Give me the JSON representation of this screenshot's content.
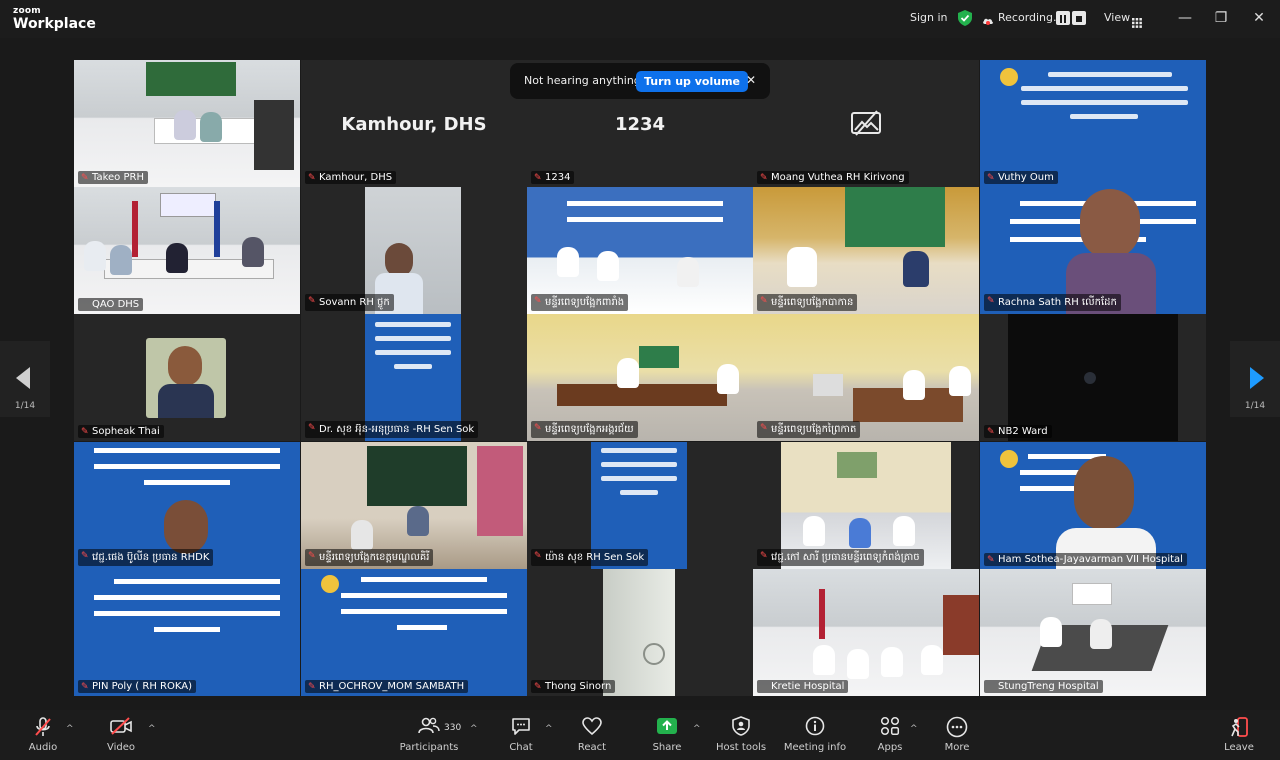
{
  "app": {
    "logo_top": "zoom",
    "logo_bottom": "Workplace"
  },
  "titlebar": {
    "sign_in": "Sign in",
    "recording": "Recording...",
    "view": "View"
  },
  "toast": {
    "message": "Not hearing anything?",
    "button": "Turn up volume",
    "close": "✕"
  },
  "pager": {
    "left": "1/14",
    "right": "1/14"
  },
  "tiles": [
    {
      "name": "Takeo PRH"
    },
    {
      "name": "Kamhour, DHS",
      "big": "Kamhour, DHS"
    },
    {
      "name": "1234",
      "big": "1234"
    },
    {
      "name": "Moang Vuthea RH Kirivong"
    },
    {
      "name": "Vuthy Oum"
    },
    {
      "name": "QAO DHS"
    },
    {
      "name": "Sovann RH ថ្លូក"
    },
    {
      "name": "មន្ទីរពេទ្យបង្អែកពារាំង"
    },
    {
      "name": "មន្ទីរពេទ្យបង្អែកបាកាន"
    },
    {
      "name": "Rachna Sath RH លើកដែក"
    },
    {
      "name": "Sopheak Thai"
    },
    {
      "name": "Dr. សុខ អ៊ុន-អនុប្រធាន -RH Sen Sok"
    },
    {
      "name": "មន្ទីរពេទ្យបង្អែកអង្គរជ័យ"
    },
    {
      "name": "មន្ទីរពេទ្យបង្អែកព្រៃកាត"
    },
    {
      "name": "NB2 Ward"
    },
    {
      "name": "វេជ្ជ.ផេង ប៊ូលីន ប្រធាន RHDK"
    },
    {
      "name": "មន្ទីរពេទ្យបង្អែកខេត្តមណ្ឌលគិរី"
    },
    {
      "name": "យ៉ាន សុខ RH Sen Sok"
    },
    {
      "name": "វេជ្ជ.កៅ សារី ប្រធានមន្ទីរពេទ្យកំពង់ត្រាច"
    },
    {
      "name": "Ham Sothea-Jayavarman VII Hospital"
    },
    {
      "name": "PIN Poly ( RH ROKA)"
    },
    {
      "name": "RH_OCHROV_MOM SAMBATH"
    },
    {
      "name": "Thong Sinorn"
    },
    {
      "name": "Kretie Hospital"
    },
    {
      "name": "StungTreng Hospital"
    }
  ],
  "toolbar": {
    "audio": "Audio",
    "video": "Video",
    "participants": "Participants",
    "participants_count": "330",
    "chat": "Chat",
    "react": "React",
    "share": "Share",
    "host_tools": "Host tools",
    "meeting_info": "Meeting info",
    "apps": "Apps",
    "more": "More",
    "leave": "Leave"
  },
  "colors": {
    "accent": "#0e71eb",
    "active_speaker": "#3ccf6e",
    "share_green": "#23b14d",
    "muted_red": "#ff4d4d"
  }
}
